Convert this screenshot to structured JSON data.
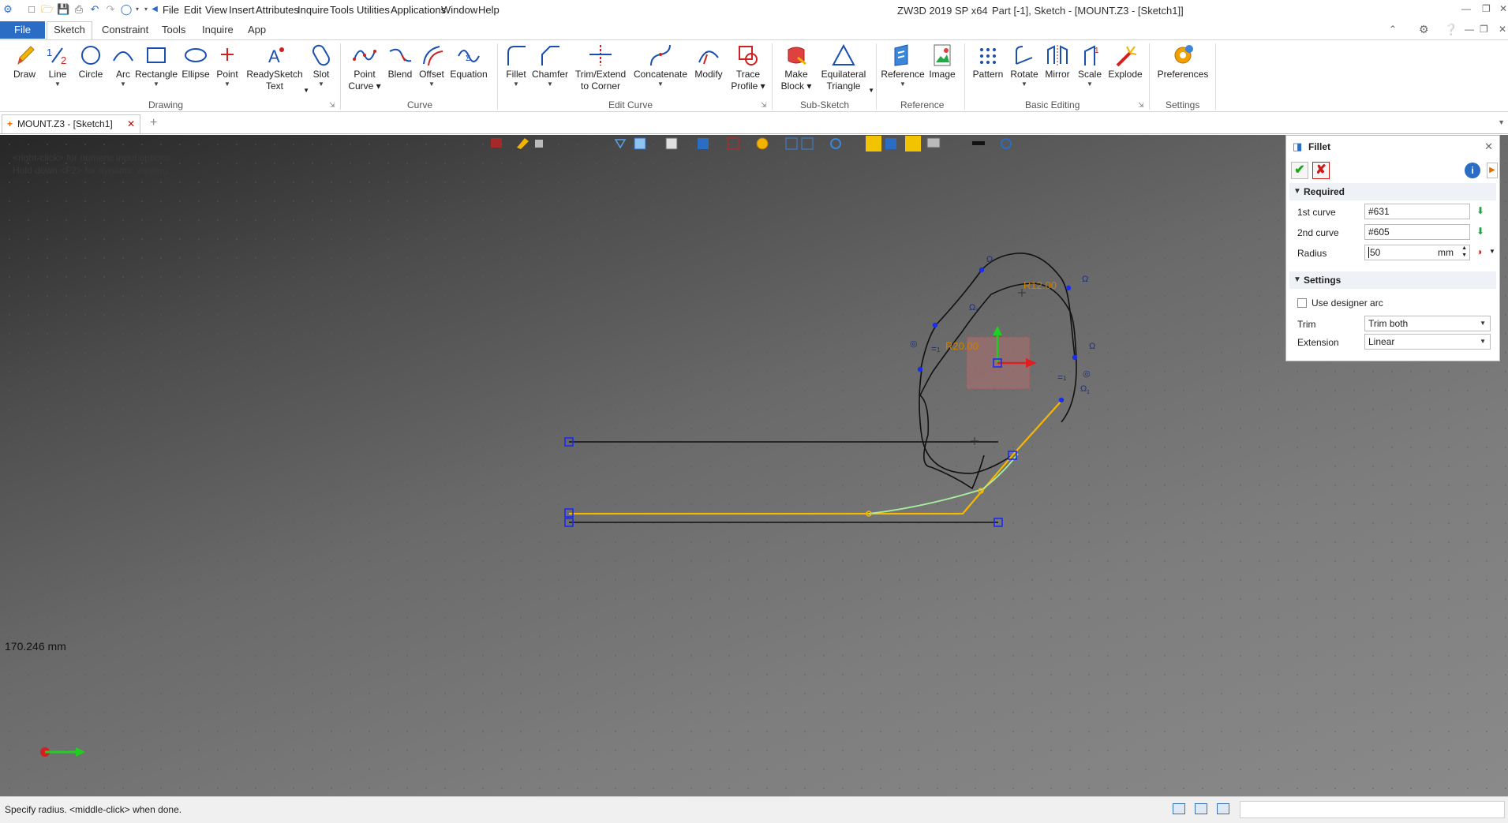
{
  "titlebar": {
    "menu": [
      "File",
      "Edit",
      "View",
      "Insert",
      "Attributes",
      "Inquire",
      "Tools",
      "Utilities",
      "Applications",
      "Window",
      "Help"
    ],
    "app_title": "ZW3D 2019 SP x64",
    "doc_title": "Part [-1],  Sketch - [MOUNT.Z3 - [Sketch1]]"
  },
  "ribbon_tabs": {
    "file": "File",
    "tabs": [
      "Sketch",
      "Constraint",
      "Tools",
      "Inquire",
      "App"
    ]
  },
  "ribbon": {
    "drawing": {
      "label": "Drawing",
      "tools": [
        {
          "label": "Draw",
          "label2": "",
          "dropdown": false
        },
        {
          "label": "Line",
          "label2": "",
          "dropdown": true
        },
        {
          "label": "Circle",
          "label2": "",
          "dropdown": false
        },
        {
          "label": "Arc",
          "label2": "",
          "dropdown": true
        },
        {
          "label": "Rectangle",
          "label2": "",
          "dropdown": true
        },
        {
          "label": "Ellipse",
          "label2": "",
          "dropdown": false
        },
        {
          "label": "Point",
          "label2": "",
          "dropdown": true
        },
        {
          "label": "ReadySketch",
          "label2": "Text",
          "dropdown": true
        },
        {
          "label": "Slot",
          "label2": "",
          "dropdown": true
        }
      ]
    },
    "curve": {
      "label": "Curve",
      "tools": [
        {
          "label": "Point",
          "label2": "Curve ▾"
        },
        {
          "label": "Blend",
          "label2": ""
        },
        {
          "label": "Offset",
          "label2": ""
        },
        {
          "label": "Equation",
          "label2": ""
        }
      ]
    },
    "edit_curve": {
      "label": "Edit Curve",
      "tools": [
        {
          "label": "Fillet",
          "label2": ""
        },
        {
          "label": "Chamfer",
          "label2": ""
        },
        {
          "label": "Trim/Extend",
          "label2": "to Corner"
        },
        {
          "label": "Concatenate",
          "label2": ""
        },
        {
          "label": "Modify",
          "label2": ""
        },
        {
          "label": "Trace",
          "label2": "Profile ▾"
        }
      ]
    },
    "sub_sketch": {
      "label": "Sub-Sketch",
      "tools": [
        {
          "label": "Make",
          "label2": "Block ▾"
        },
        {
          "label": "Equilateral",
          "label2": "Triangle"
        }
      ]
    },
    "reference": {
      "label": "Reference",
      "tools": [
        {
          "label": "Reference",
          "label2": ""
        },
        {
          "label": "Image",
          "label2": ""
        }
      ]
    },
    "basic_editing": {
      "label": "Basic Editing",
      "tools": [
        {
          "label": "Pattern",
          "label2": ""
        },
        {
          "label": "Rotate",
          "label2": ""
        },
        {
          "label": "Mirror",
          "label2": ""
        },
        {
          "label": "Scale",
          "label2": ""
        },
        {
          "label": "Explode",
          "label2": ""
        }
      ]
    },
    "settings": {
      "label": "Settings",
      "tools": [
        {
          "label": "Preferences",
          "label2": ""
        }
      ]
    }
  },
  "doc_tabs": {
    "active": "MOUNT.Z3 - [Sketch1]"
  },
  "viewport": {
    "hint_line1": "<right-click> for numeric input options.",
    "hint_line2": "Hold down <F2> for dynamic viewing.",
    "dim_r12": "R12.00",
    "dim_r20": "R20.00",
    "coord_readout": "170.246 mm",
    "constraint_eq": "=",
    "constraint_sub": "1"
  },
  "fillet_panel": {
    "title": "Fillet",
    "required": {
      "header": "Required",
      "first_curve_label": "1st curve",
      "first_curve_value": "#631",
      "second_curve_label": "2nd curve",
      "second_curve_value": "#605",
      "radius_label": "Radius",
      "radius_value": "50",
      "radius_unit": "mm"
    },
    "settings": {
      "header": "Settings",
      "use_designer_arc_label": "Use designer arc",
      "use_designer_arc_checked": false,
      "trim_label": "Trim",
      "trim_value": "Trim both",
      "extension_label": "Extension",
      "extension_value": "Linear"
    }
  },
  "statusbar": {
    "text": "Specify radius.  <middle-click> when done."
  },
  "colors": {
    "accent": "#2b6cc4",
    "selection_orange": "#f5b700",
    "preview_green": "#a8f0a0",
    "sketch_point_blue": "#1a2cf0"
  }
}
